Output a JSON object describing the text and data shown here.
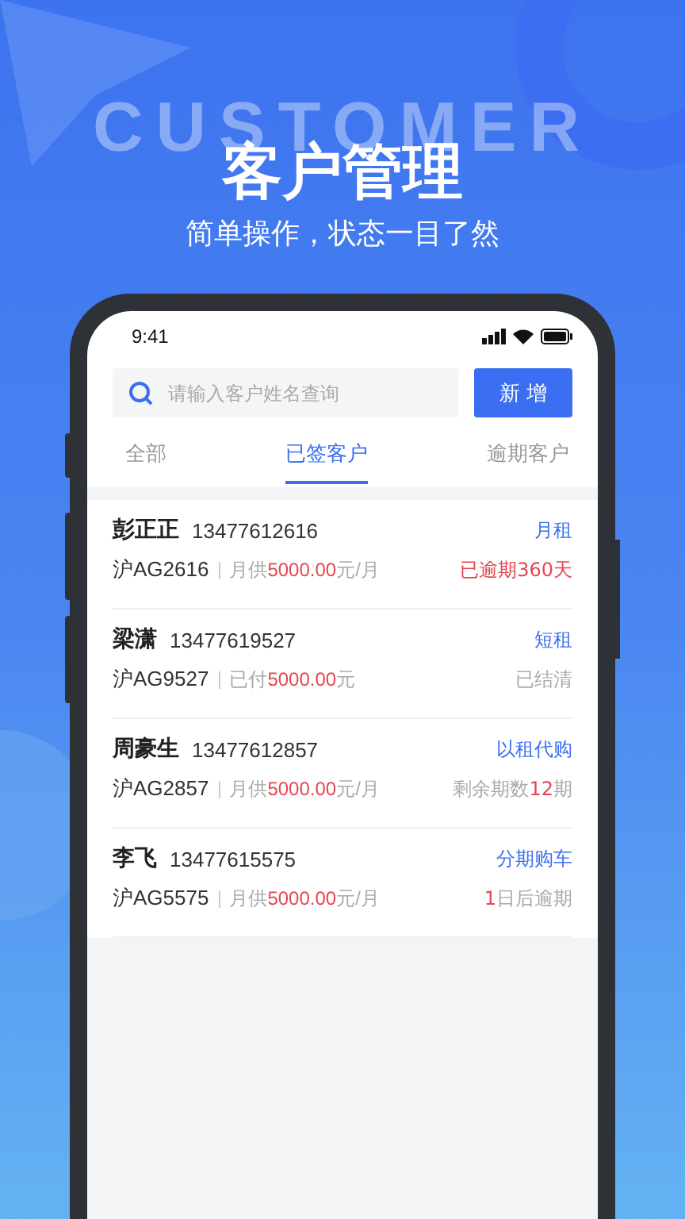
{
  "banner": {
    "watermark": "CUSTOMER",
    "title": "客户管理",
    "subtitle": "简单操作，状态一目了然"
  },
  "status_bar": {
    "time": "9:41"
  },
  "search": {
    "placeholder": "请输入客户姓名查询"
  },
  "add_button": "新 增",
  "tabs": [
    {
      "label": "全部",
      "selected": false
    },
    {
      "label": "已签客户",
      "selected": true
    },
    {
      "label": "逾期客户",
      "selected": false
    }
  ],
  "customers": [
    {
      "name": "彭正正",
      "phone": "13477612616",
      "type": "月租",
      "plate": "沪AG2616",
      "payment": [
        {
          "text": "月供",
          "alert": false
        },
        {
          "text": "5000.00",
          "alert": true
        },
        {
          "text": "元/月",
          "alert": false
        }
      ],
      "status": [
        {
          "text": "已逾期360天",
          "alert": true
        }
      ]
    },
    {
      "name": "梁潇",
      "phone": "13477619527",
      "type": "短租",
      "plate": "沪AG9527",
      "payment": [
        {
          "text": "已付",
          "alert": false
        },
        {
          "text": "5000.00",
          "alert": true
        },
        {
          "text": "元",
          "alert": false
        }
      ],
      "status": [
        {
          "text": "已结清",
          "alert": false
        }
      ]
    },
    {
      "name": "周豪生",
      "phone": "13477612857",
      "type": "以租代购",
      "plate": "沪AG2857",
      "payment": [
        {
          "text": "月供",
          "alert": false
        },
        {
          "text": "5000.00",
          "alert": true
        },
        {
          "text": "元/月",
          "alert": false
        }
      ],
      "status": [
        {
          "text": "剩余期数",
          "alert": false
        },
        {
          "text": "12",
          "alert": true
        },
        {
          "text": "期",
          "alert": false
        }
      ]
    },
    {
      "name": "李飞",
      "phone": "13477615575",
      "type": "分期购车",
      "plate": "沪AG5575",
      "payment": [
        {
          "text": "月供",
          "alert": false
        },
        {
          "text": "5000.00",
          "alert": true
        },
        {
          "text": "元/月",
          "alert": false
        }
      ],
      "status": [
        {
          "text": "1",
          "alert": true
        },
        {
          "text": "日后逾期",
          "alert": false
        }
      ]
    }
  ]
}
